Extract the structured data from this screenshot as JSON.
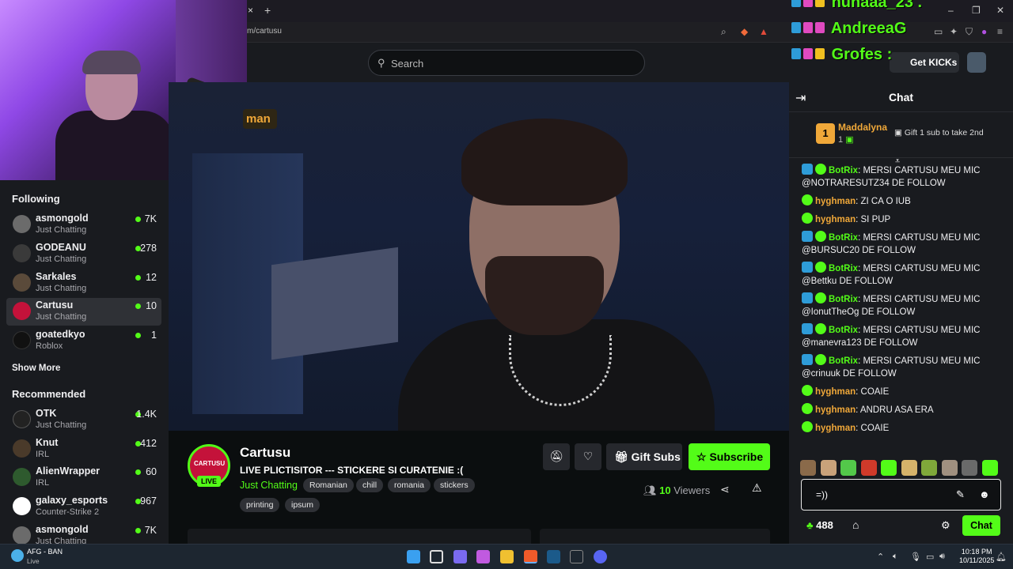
{
  "browser": {
    "url": "m/cartusu",
    "tab_close": "×",
    "new_tab": "+",
    "win_min": "–",
    "win_max": "❐",
    "win_close": "✕"
  },
  "topbar": {
    "search_placeholder": "Search",
    "get_kicks": "Get KICKs"
  },
  "overlay_chat": [
    {
      "name": "nunaaa_23 ."
    },
    {
      "name": "AndreeaG"
    },
    {
      "name": "Grofes :"
    }
  ],
  "sidebar": {
    "following_title": "Following",
    "following": [
      {
        "name": "asmongold",
        "category": "Just Chatting",
        "viewers": "7K",
        "avatar_color": "#6b6b6b"
      },
      {
        "name": "GODEANU",
        "category": "Just Chatting",
        "viewers": "278",
        "avatar_color": "#3a3a3a"
      },
      {
        "name": "Sarkales",
        "category": "Just Chatting",
        "viewers": "12",
        "avatar_color": "#5a4a3a"
      },
      {
        "name": "Cartusu",
        "category": "Just Chatting",
        "viewers": "10",
        "avatar_color": "#c4123a"
      },
      {
        "name": "goatedkyo",
        "category": "Roblox",
        "viewers": "1",
        "avatar_color": "#111111"
      }
    ],
    "show_more": "Show More",
    "recommended_title": "Recommended",
    "recommended": [
      {
        "name": "OTK",
        "category": "Just Chatting",
        "viewers": "1.4K",
        "avatar_color": "#222222"
      },
      {
        "name": "Knut",
        "category": "IRL",
        "viewers": "412",
        "avatar_color": "#4a3a2a"
      },
      {
        "name": "AlienWrapper",
        "category": "IRL",
        "viewers": "60",
        "avatar_color": "#2e5a2e"
      },
      {
        "name": "galaxy_esports",
        "category": "Counter-Strike 2",
        "viewers": "967",
        "avatar_color": "#ffffff"
      },
      {
        "name": "asmongold",
        "category": "Just Chatting",
        "viewers": "7K",
        "avatar_color": "#6b6b6b"
      }
    ]
  },
  "video": {
    "overlay_tag": "man"
  },
  "stream": {
    "avatar_text": "CARTUSU",
    "live_label": "LIVE",
    "channel": "Cartusu",
    "title": "LIVE PLICTISITOR --- STICKERE SI CURATENIE :(",
    "category": "Just Chatting",
    "tags": [
      "Romanian",
      "chill",
      "romania",
      "stickers",
      "printing",
      "ipsum"
    ],
    "gift_subs": "Gift Subs",
    "subscribe": "Subscribe",
    "viewers_count": "10",
    "viewers_label": "Viewers"
  },
  "chat": {
    "title": "Chat",
    "pinned": {
      "rank": "1",
      "user": "Maddalyna",
      "count": "1",
      "gift_text": "Gift 1 sub to take 2nd"
    },
    "messages": [
      {
        "user": "BotRix",
        "bot": true,
        "color": "#53fc18",
        "text": "MERSI CARTUSU MEU MIC @NOTRARESUTZ34 DE FOLLOW"
      },
      {
        "user": "hyghman",
        "bot": false,
        "color": "#f0a839",
        "text": "ZI CA O IUB"
      },
      {
        "user": "hyghman",
        "bot": false,
        "color": "#f0a839",
        "text": "SI PUP"
      },
      {
        "user": "BotRix",
        "bot": true,
        "color": "#53fc18",
        "text": "MERSI CARTUSU MEU MIC @BURSUC20 DE FOLLOW"
      },
      {
        "user": "BotRix",
        "bot": true,
        "color": "#53fc18",
        "text": "MERSI CARTUSU MEU MIC @Bettku DE FOLLOW"
      },
      {
        "user": "BotRix",
        "bot": true,
        "color": "#53fc18",
        "text": "MERSI CARTUSU MEU MIC @IonutTheOg DE FOLLOW"
      },
      {
        "user": "BotRix",
        "bot": true,
        "color": "#53fc18",
        "text": "MERSI CARTUSU MEU MIC @manevra123 DE FOLLOW"
      },
      {
        "user": "BotRix",
        "bot": true,
        "color": "#53fc18",
        "text": "MERSI CARTUSU MEU MIC @crinuuk DE FOLLOW"
      },
      {
        "user": "hyghman",
        "bot": false,
        "color": "#f0a839",
        "text": "COAIE"
      },
      {
        "user": "hyghman",
        "bot": false,
        "color": "#f0a839",
        "text": "ANDRU ASA ERA"
      },
      {
        "user": "hyghman",
        "bot": false,
        "color": "#f0a839",
        "text": "COAIE"
      }
    ],
    "emote_colors": [
      "#8a6a4a",
      "#c9a27a",
      "#53c84a",
      "#d03a2a",
      "#53fc18",
      "#d6b36a",
      "#7fa83a",
      "#a09080",
      "#6a6a6a",
      "#53fc18"
    ],
    "input_value": "=))",
    "points": "488",
    "send_label": "Chat"
  },
  "taskbar": {
    "score": "AFG - BAN",
    "live": "Live",
    "time": "10:18 PM",
    "date": "10/11/2025"
  }
}
